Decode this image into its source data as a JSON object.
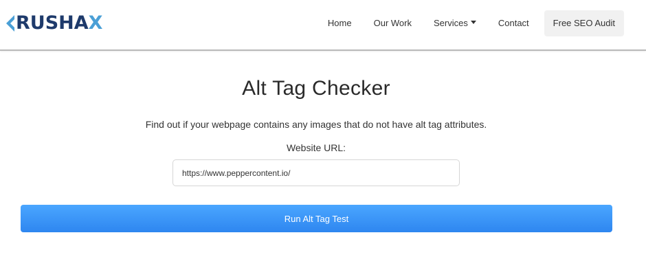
{
  "brand": {
    "logo_text": "RUSHA",
    "logo_x": "X",
    "logo_colors": {
      "primary": "#1e3a6b",
      "accent": "#4a9fd6"
    }
  },
  "nav": {
    "items": [
      {
        "label": "Home"
      },
      {
        "label": "Our Work"
      },
      {
        "label": "Services",
        "icon": "caret-down-icon"
      },
      {
        "label": "Contact"
      }
    ],
    "cta_label": "Free SEO Audit"
  },
  "main": {
    "title": "Alt Tag Checker",
    "description": "Find out if your webpage contains any images that do not have alt tag attributes.",
    "url_label": "Website URL:",
    "url_value": "https://www.peppercontent.io/",
    "run_button_label": "Run Alt Tag Test"
  },
  "colors": {
    "button_top": "#4aa6ff",
    "button_bottom": "#2e86f0",
    "cta_bg": "#f1f1f1"
  }
}
